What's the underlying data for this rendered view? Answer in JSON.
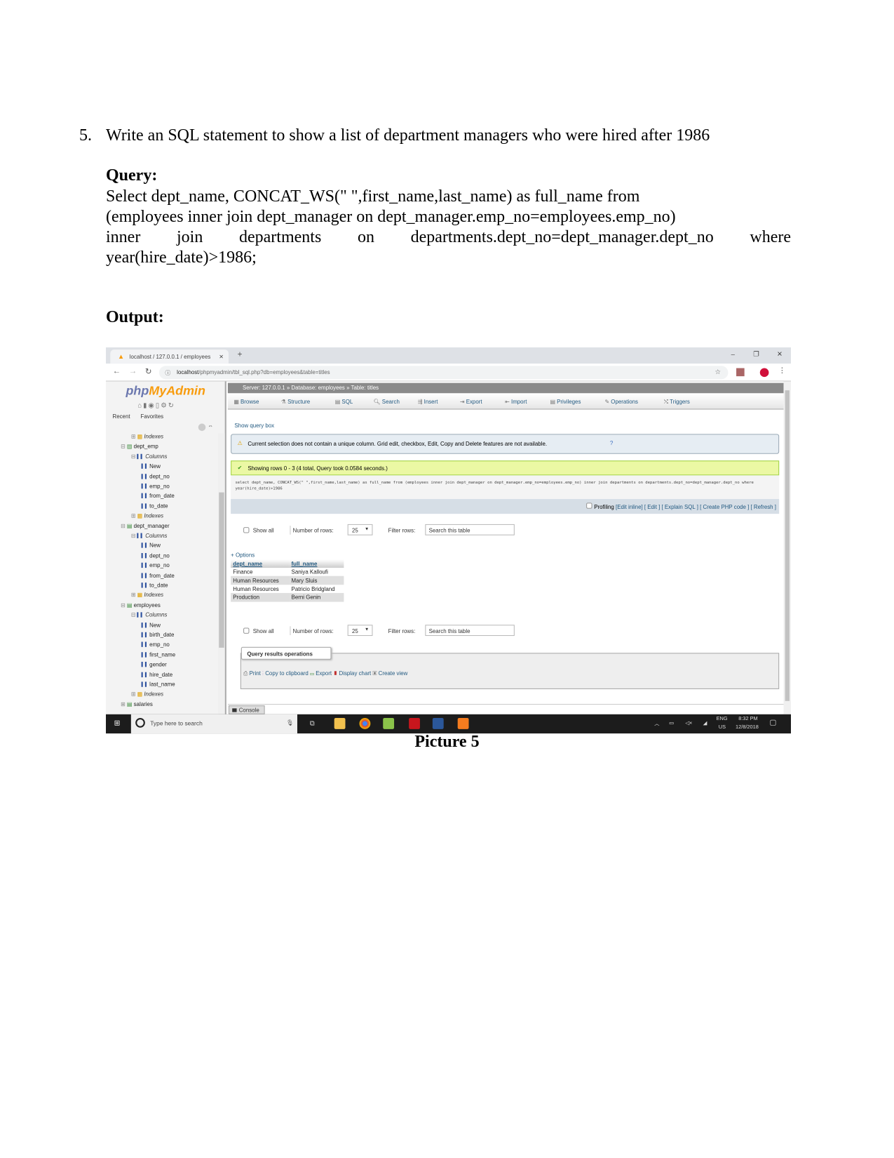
{
  "document": {
    "question_number": "5.",
    "question_text": "Write an SQL statement to show a list of department managers who were hired after 1986",
    "query_label": "Query:",
    "query_lines": [
      "Select dept_name, CONCAT_WS(\" \",first_name,last_name) as full_name from",
      "(employees inner join dept_manager on dept_manager.emp_no=employees.emp_no)",
      "inner join departments on departments.dept_no=dept_manager.dept_no where",
      "year(hire_date)>1986;"
    ],
    "output_label": "Output:",
    "caption": "Picture 5"
  },
  "browser": {
    "tab_title": "localhost / 127.0.0.1 / employees",
    "new_tab": "+",
    "url_host": "localhost",
    "url_path": "/phpmyadmin/tbl_sql.php?db=employees&table=titles",
    "window_controls": [
      "–",
      "❐",
      "✕"
    ]
  },
  "sidebar": {
    "logo_php": "php",
    "logo_myadmin": "MyAdmin",
    "tabs": [
      "Recent",
      "Favorites"
    ],
    "tree": [
      {
        "label": "Indexes",
        "type": "indexes",
        "level": 1
      },
      {
        "label": "dept_emp",
        "type": "table",
        "level": 0
      },
      {
        "label": "Columns",
        "type": "columns",
        "level": 1
      },
      {
        "label": "New",
        "type": "column",
        "level": 2
      },
      {
        "label": "dept_no",
        "type": "column",
        "level": 2
      },
      {
        "label": "emp_no",
        "type": "column",
        "level": 2
      },
      {
        "label": "from_date",
        "type": "column",
        "level": 2
      },
      {
        "label": "to_date",
        "type": "column",
        "level": 2
      },
      {
        "label": "Indexes",
        "type": "indexes",
        "level": 1
      },
      {
        "label": "dept_manager",
        "type": "table",
        "level": 0
      },
      {
        "label": "Columns",
        "type": "columns",
        "level": 1
      },
      {
        "label": "New",
        "type": "column",
        "level": 2
      },
      {
        "label": "dept_no",
        "type": "column",
        "level": 2
      },
      {
        "label": "emp_no",
        "type": "column",
        "level": 2
      },
      {
        "label": "from_date",
        "type": "column",
        "level": 2
      },
      {
        "label": "to_date",
        "type": "column",
        "level": 2
      },
      {
        "label": "Indexes",
        "type": "indexes",
        "level": 1
      },
      {
        "label": "employees",
        "type": "table",
        "level": 0
      },
      {
        "label": "Columns",
        "type": "columns",
        "level": 1
      },
      {
        "label": "New",
        "type": "column",
        "level": 2
      },
      {
        "label": "birth_date",
        "type": "column",
        "level": 2
      },
      {
        "label": "emp_no",
        "type": "column",
        "level": 2
      },
      {
        "label": "first_name",
        "type": "column",
        "level": 2
      },
      {
        "label": "gender",
        "type": "column",
        "level": 2
      },
      {
        "label": "hire_date",
        "type": "column",
        "level": 2
      },
      {
        "label": "last_name",
        "type": "column",
        "level": 2
      },
      {
        "label": "Indexes",
        "type": "indexes",
        "level": 1
      },
      {
        "label": "salaries",
        "type": "table",
        "level": 0
      }
    ]
  },
  "main": {
    "breadcrumb": "Server: 127.0.0.1 » Database: employees » Table: titles",
    "menu": [
      "Browse",
      "Structure",
      "SQL",
      "Search",
      "Insert",
      "Export",
      "Import",
      "Privileges",
      "Operations",
      "Triggers"
    ],
    "show_query_box": "Show query box",
    "warning": "Current selection does not contain a unique column. Grid edit, checkbox, Edit, Copy and Delete features are not available.",
    "success": "Showing rows 0 - 3 (4 total, Query took 0.0584 seconds.)",
    "executed_sql": "select dept_name, CONCAT_WS(\" \",first_name,last_name) as full_name from (employees inner join dept_manager on dept_manager.emp_no=employees.emp_no) inner join departments on departments.dept_no=dept_manager.dept_no where year(hire_date)>1986",
    "profiling": "Profiling",
    "sql_links": [
      "[Edit inline]",
      "[ Edit ]",
      "[ Explain SQL ]",
      "[ Create PHP code ]",
      "[ Refresh ]"
    ],
    "controls": {
      "show_all": "Show all",
      "rows_label": "Number of rows:",
      "rows_value": "25",
      "filter_label": "Filter rows:",
      "filter_placeholder": "Search this table"
    },
    "options": "+ Options",
    "results": {
      "columns": [
        "dept_name",
        "full_name"
      ],
      "rows": [
        [
          "Finance",
          "Saniya Kalloufi"
        ],
        [
          "Human Resources",
          "Mary Sluis"
        ],
        [
          "Human Resources",
          "Patricio Bridgland"
        ],
        [
          "Production",
          "Berni Genin"
        ]
      ]
    },
    "ops_legend": "Query results operations",
    "ops": [
      "Print",
      "Copy to clipboard",
      "Export",
      "Display chart",
      "Create view"
    ],
    "console": "Console"
  },
  "taskbar": {
    "search_placeholder": "Type here to search",
    "lang": "ENG",
    "region": "US",
    "time": "8:32 PM",
    "date": "12/8/2018"
  },
  "colors": {
    "pma_accent": "#235a81",
    "success_bg": "#ebf8a4",
    "logo_orange": "#f89c0e",
    "logo_blue": "#6c78af"
  }
}
